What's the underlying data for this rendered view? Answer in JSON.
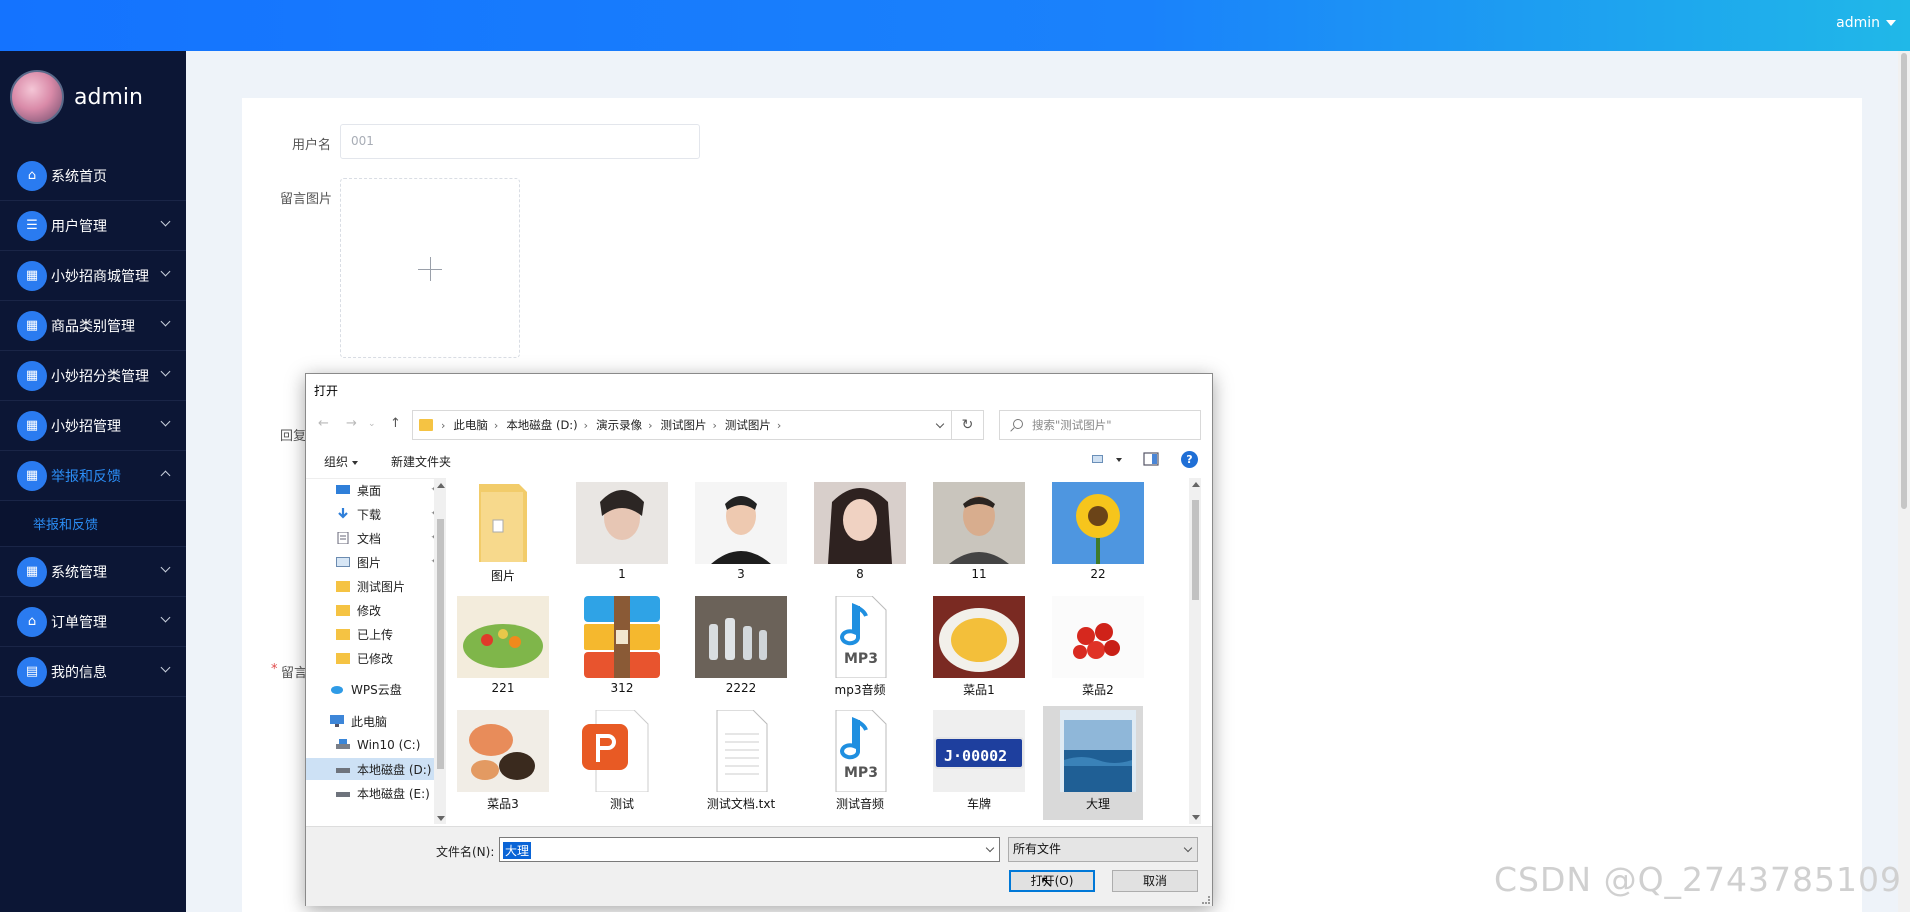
{
  "header": {
    "user_label": "admin"
  },
  "sidebar": {
    "profile_name": "admin",
    "items": [
      {
        "label": "系统首页",
        "icon": "home-icon"
      },
      {
        "label": "用户管理",
        "icon": "list-icon"
      },
      {
        "label": "小妙招商城管理",
        "icon": "chart-icon"
      },
      {
        "label": "商品类别管理",
        "icon": "grid-icon"
      },
      {
        "label": "小妙招分类管理",
        "icon": "grid-icon"
      },
      {
        "label": "小妙招管理",
        "icon": "grid-icon"
      },
      {
        "label": "举报和反馈",
        "icon": "grid-icon"
      },
      {
        "label": "系统管理",
        "icon": "grid-icon"
      },
      {
        "label": "订单管理",
        "icon": "store-icon"
      },
      {
        "label": "我的信息",
        "icon": "card-icon"
      }
    ],
    "sub_item": "举报和反馈"
  },
  "form": {
    "username_label": "用户名",
    "username_placeholder": "001",
    "image_label": "留言图片",
    "reply_label_partial": "回复",
    "message_label_partial": "留言",
    "required_mark": "*"
  },
  "dialog": {
    "title": "打开",
    "breadcrumbs": [
      "此电脑",
      "本地磁盘 (D:)",
      "演示录像",
      "测试图片",
      "测试图片"
    ],
    "search_placeholder": "搜索\"测试图片\"",
    "toolbar": {
      "organize": "组织",
      "new_folder": "新建文件夹",
      "help": "?"
    },
    "nav_pane": [
      {
        "label": "桌面",
        "pinned": true
      },
      {
        "label": "下载",
        "pinned": true
      },
      {
        "label": "文档",
        "pinned": true
      },
      {
        "label": "图片",
        "pinned": true
      },
      {
        "label": "测试图片",
        "pinned": false
      },
      {
        "label": "修改",
        "pinned": false
      },
      {
        "label": "已上传",
        "pinned": false
      },
      {
        "label": "已修改",
        "pinned": false
      },
      {
        "label": "WPS云盘",
        "pinned": false
      },
      {
        "label": "此电脑",
        "pinned": false
      },
      {
        "label": "Win10 (C:)",
        "pinned": false
      },
      {
        "label": "本地磁盘 (D:)",
        "pinned": false
      },
      {
        "label": "本地磁盘 (E:)",
        "pinned": false
      }
    ],
    "files": [
      {
        "name": "图片",
        "kind": "folder"
      },
      {
        "name": "1",
        "kind": "photo"
      },
      {
        "name": "3",
        "kind": "photo"
      },
      {
        "name": "8",
        "kind": "photo"
      },
      {
        "name": "11",
        "kind": "photo"
      },
      {
        "name": "22",
        "kind": "photo"
      },
      {
        "name": "221",
        "kind": "photo"
      },
      {
        "name": "312",
        "kind": "archive"
      },
      {
        "name": "2222",
        "kind": "photo"
      },
      {
        "name": "mp3音频",
        "kind": "mp3"
      },
      {
        "name": "菜品1",
        "kind": "photo"
      },
      {
        "name": "菜品2",
        "kind": "photo"
      },
      {
        "name": "菜品3",
        "kind": "photo"
      },
      {
        "name": "测试",
        "kind": "ppt"
      },
      {
        "name": "测试文档.txt",
        "kind": "txt"
      },
      {
        "name": "测试音频",
        "kind": "mp3"
      },
      {
        "name": "车牌",
        "kind": "plate"
      },
      {
        "name": "大理",
        "kind": "photo"
      }
    ],
    "mp3_badge": "MP3",
    "plate_text": "J·00002",
    "filename_label": "文件名(N):",
    "filename_value": "大理",
    "filetype_value": "所有文件",
    "open_button": "打开(O)",
    "cancel_button": "取消"
  },
  "watermark": "CSDN @Q_2743785109",
  "colors": {
    "accent": "#2b8df5",
    "sidebar_bg": "#0c1635",
    "selection": "#0a64d6"
  }
}
